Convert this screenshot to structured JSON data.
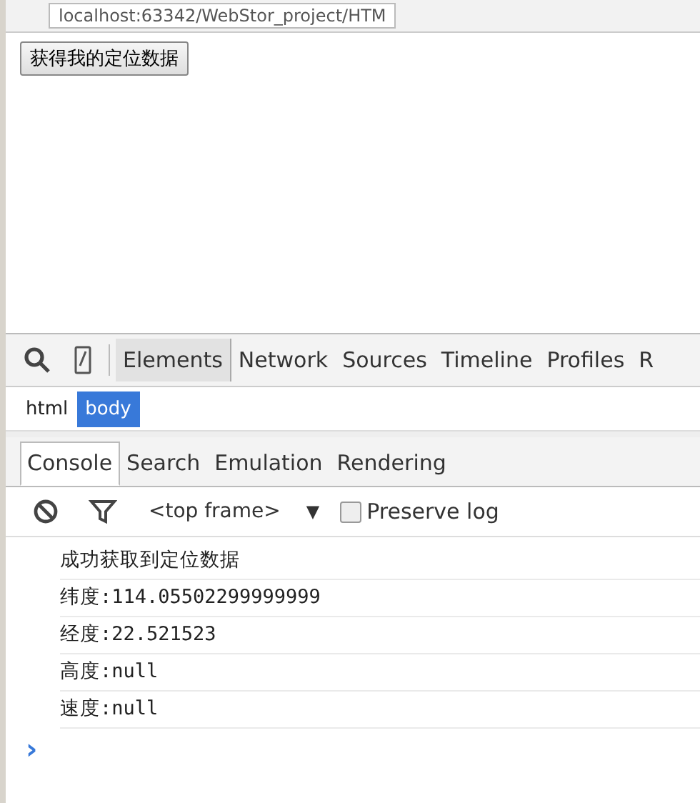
{
  "address_bar": {
    "url": "localhost:63342/WebStor_project/HTM"
  },
  "page": {
    "button": "获得我的定位数据"
  },
  "devtools": {
    "tabs": [
      {
        "label": "Elements",
        "selected": true
      },
      {
        "label": "Network",
        "selected": false
      },
      {
        "label": "Sources",
        "selected": false
      },
      {
        "label": "Timeline",
        "selected": false
      },
      {
        "label": "Profiles",
        "selected": false
      },
      {
        "label": "R",
        "selected": false
      }
    ],
    "breadcrumbs": [
      {
        "label": "html",
        "selected": false
      },
      {
        "label": "body",
        "selected": true
      }
    ],
    "drawer_tabs": [
      {
        "label": "Console",
        "selected": true
      },
      {
        "label": "Search",
        "selected": false
      },
      {
        "label": "Emulation",
        "selected": false
      },
      {
        "label": "Rendering",
        "selected": false
      }
    ],
    "console_toolbar": {
      "frame": "<top frame>",
      "dropdown": "▼",
      "preserve_log": {
        "label": "Preserve log",
        "checked": false
      }
    },
    "messages": [
      "成功获取到定位数据",
      "纬度:114.05502299999999",
      "经度:22.521523",
      "高度:null",
      "速度:null"
    ],
    "prompt": "›"
  }
}
